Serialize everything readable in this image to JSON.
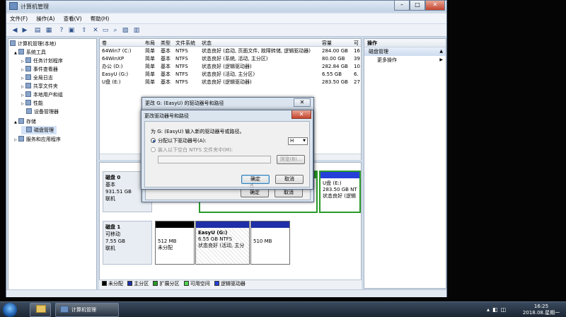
{
  "window": {
    "title": "计算机管理",
    "menu": [
      "文件(F)",
      "操作(A)",
      "查看(V)",
      "帮助(H)"
    ]
  },
  "tree": {
    "items": [
      {
        "label": "计算机管理(本地)",
        "indent": 0,
        "expander": ""
      },
      {
        "label": "系统工具",
        "indent": 1,
        "expander": "▲"
      },
      {
        "label": "任务计划程序",
        "indent": 2,
        "expander": "▷"
      },
      {
        "label": "事件查看器",
        "indent": 2,
        "expander": "▷"
      },
      {
        "label": "共享文件夹",
        "indent": 2,
        "expander": "▷"
      },
      {
        "label": "共享文件夹",
        "indent": 2,
        "expander": "▷"
      },
      {
        "label": "本地用户和组",
        "indent": 2,
        "expander": "▷"
      },
      {
        "label": "性能",
        "indent": 2,
        "expander": "▷"
      },
      {
        "label": "设备管理器",
        "indent": 2,
        "expander": ""
      },
      {
        "label": "存储",
        "indent": 1,
        "expander": "▲"
      },
      {
        "label": "磁盘管理",
        "indent": 2,
        "expander": ""
      },
      {
        "label": "服务和应用程序",
        "indent": 1,
        "expander": "▷"
      }
    ]
  },
  "volumes": {
    "headers": [
      "卷",
      "布局",
      "类型",
      "文件系统",
      "状态",
      "容量",
      "可"
    ],
    "rows": [
      [
        "64Win7 (C:)",
        "简单",
        "基本",
        "NTFS",
        "状态良好 (启动, 页面文件, 故障转储, 逻辑驱动器)",
        "284.00 GB",
        "16"
      ],
      [
        "64WinXP",
        "简单",
        "基本",
        "NTFS",
        "状态良好 (系统, 活动, 主分区)",
        "80.00 GB",
        "39"
      ],
      [
        "办公 (D:)",
        "简单",
        "基本",
        "NTFS",
        "状态良好 (逻辑驱动器)",
        "282.84 GB",
        "10"
      ],
      [
        "EasyU (G:)",
        "简单",
        "基本",
        "NTFS",
        "状态良好 (活动, 主分区)",
        "6.55 GB",
        "6."
      ],
      [
        "U盘 (E:)",
        "简单",
        "基本",
        "NTFS",
        "状态良好 (逻辑驱动器)",
        "283.50 GB",
        "27"
      ]
    ]
  },
  "disks": [
    {
      "name": "磁盘 0",
      "type": "基本",
      "size": "931.51 GB",
      "status": "联机"
    },
    {
      "name": "磁盘 1",
      "type": "可移动",
      "size": "7.55 GB",
      "status": "联机"
    }
  ],
  "disk0_parts": {
    "p_buttons": [
      "确定",
      "取消"
    ],
    "last": {
      "name": "U盘 (E:)",
      "size": "283.50 GB NTF",
      "status": "状态良好 (逻辑"
    }
  },
  "disk1_parts": [
    {
      "line1": "",
      "line2": "512 MB",
      "line3": "未分配"
    },
    {
      "line1": "EasyU (G:)",
      "line2": "6.55 GB NTFS",
      "line3": "状态良好 (活动, 主分"
    },
    {
      "line1": "",
      "line2": "510 MB",
      "line3": ""
    }
  ],
  "legend": [
    "未分配",
    "主分区",
    "扩展分区",
    "可用空间",
    "逻辑驱动器"
  ],
  "colors": {
    "unallocated": "#000000",
    "primary": "#1e2fa8",
    "extended": "#2a9a2a",
    "free": "#4fd44f",
    "logical": "#2540d8",
    "close_red": "#c4452e"
  },
  "actions": {
    "header": "操作",
    "section": "磁盘管理",
    "more": "更多操作"
  },
  "dialog_outer": {
    "title": "更改 G: (EasyU) 的驱动器号和路径",
    "close": "✕",
    "ok": "确定",
    "cancel": "取消"
  },
  "dialog_inner": {
    "title": "更改驱动器号和路径",
    "close": "✕",
    "prompt": "为 G: (EasyU) 输入新的驱动器号或路径。",
    "option_letter": "分配以下驱动器号(A):",
    "letter_value": "H",
    "option_folder": "装入以下空白 NTFS 文件夹中(M):",
    "browse": "浏览(B)...",
    "ok": "确定",
    "cancel": "取消"
  },
  "taskbar": {
    "app": "计算机管理",
    "time": "16:25",
    "date": "2018.08.星期一"
  }
}
